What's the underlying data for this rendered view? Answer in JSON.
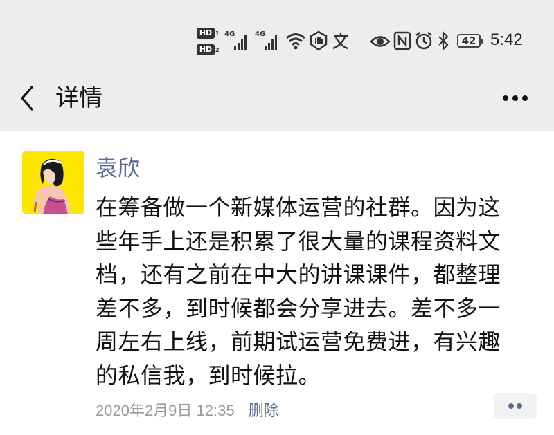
{
  "status_bar": {
    "hd1": "HD",
    "hd1_sub": "1",
    "hd2": "HD",
    "hd2_sub": "2",
    "signal1_label": "4G",
    "signal2_label": "4G",
    "icons": [
      "wifi-icon",
      "hand-icon",
      "translate-icon",
      "eye-icon",
      "nfc-icon",
      "alarm-icon",
      "bluetooth-icon"
    ],
    "battery": "42",
    "time": "5:42"
  },
  "nav": {
    "title": "详情"
  },
  "post": {
    "author": "袁欣",
    "content": "在筹备做一个新媒体运营的社群。因为这\n些年手上还是积累了很大量的课程资料文\n档，还有之前在中大的讲课课件，都整理\n差不多，到时候都会分享进去。差不多一\n周左右上线，前期试运营免费进，有兴趣\n的私信我，到时候拉。",
    "timestamp": "2020年2月9日 12:35",
    "delete_label": "删除"
  },
  "colors": {
    "header_bg": "#ededed",
    "link": "#576b95",
    "timestamp": "#9a9a9a",
    "avatar_bg": "#ffe600"
  }
}
